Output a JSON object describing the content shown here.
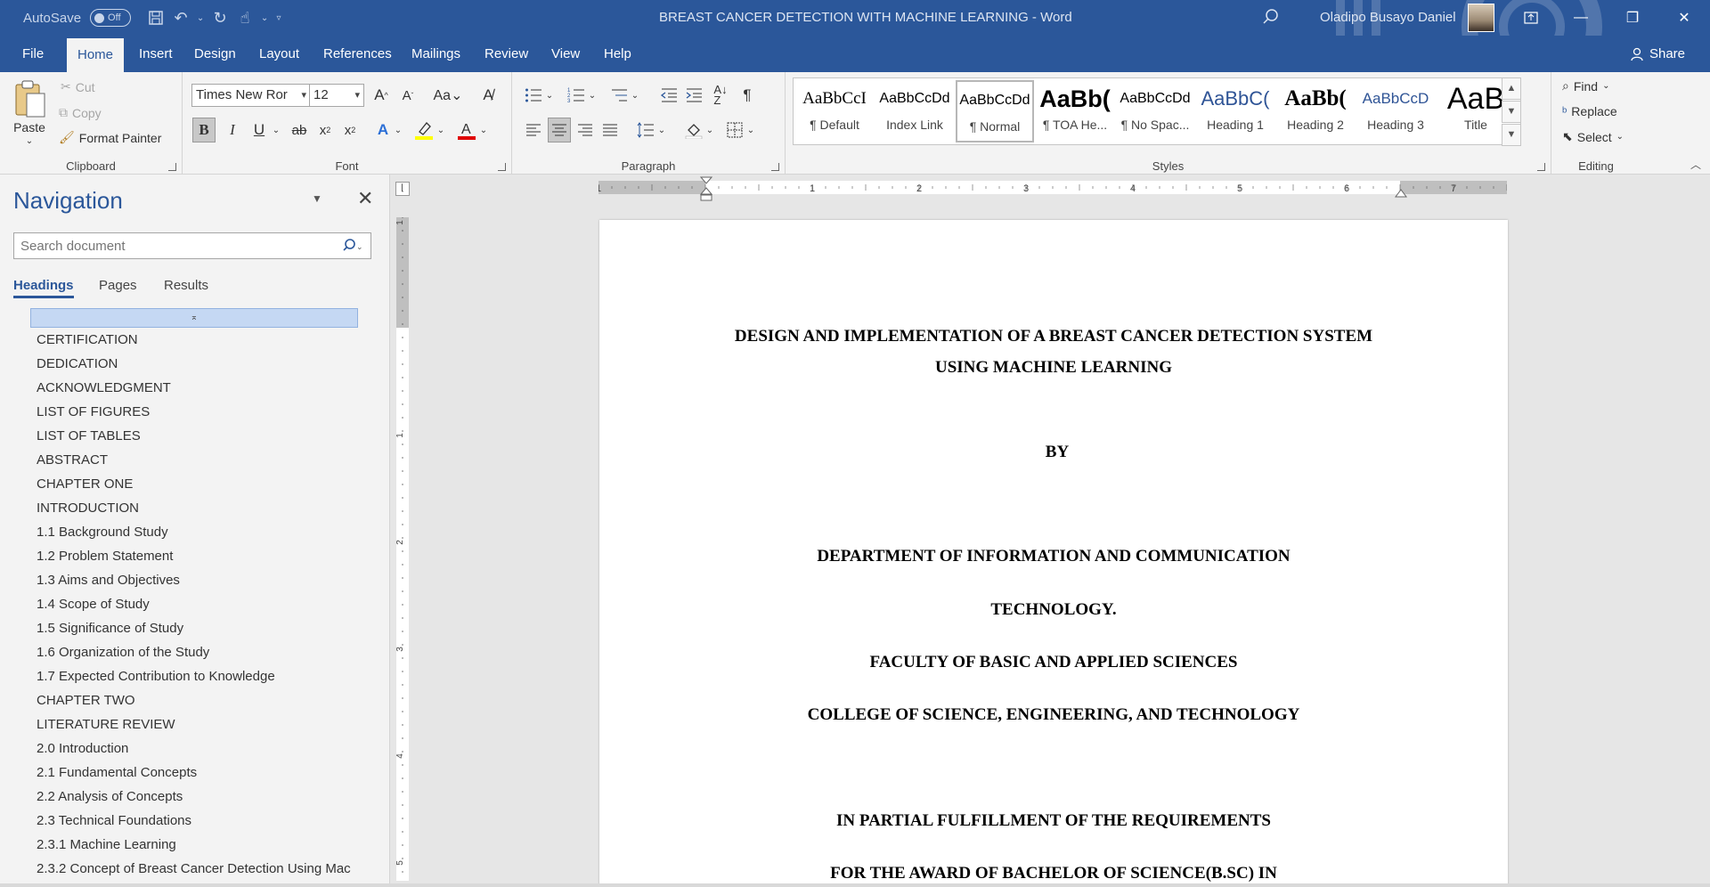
{
  "titlebar": {
    "autosave_label": "AutoSave",
    "autosave_state": "Off",
    "doc_title": "BREAST CANCER DETECTION WITH MACHINE LEARNING  -  Word",
    "user_name": "Oladipo Busayo Daniel"
  },
  "tabs": [
    "File",
    "Home",
    "Insert",
    "Design",
    "Layout",
    "References",
    "Mailings",
    "Review",
    "View",
    "Help"
  ],
  "active_tab": "Home",
  "share_label": "Share",
  "clipboard": {
    "paste": "Paste",
    "cut": "Cut",
    "copy": "Copy",
    "format_painter": "Format Painter",
    "label": "Clipboard"
  },
  "font": {
    "name": "Times New Ror",
    "size": "12",
    "label": "Font"
  },
  "paragraph": {
    "label": "Paragraph"
  },
  "styles": {
    "label": "Styles",
    "items": [
      {
        "preview": "AaBbCcI",
        "name": "¶ Default"
      },
      {
        "preview": "AaBbCcDd",
        "name": "Index Link"
      },
      {
        "preview": "AaBbCcDd",
        "name": "¶ Normal"
      },
      {
        "preview": "AaBb(",
        "name": "¶ TOA He..."
      },
      {
        "preview": "AaBbCcDd",
        "name": "¶ No Spac..."
      },
      {
        "preview": "AaBbC(",
        "name": "Heading 1"
      },
      {
        "preview": "AaBb(",
        "name": "Heading 2"
      },
      {
        "preview": "AaBbCcD",
        "name": "Heading 3"
      },
      {
        "preview": "AaB",
        "name": "Title"
      }
    ]
  },
  "editing": {
    "find": "Find",
    "replace": "Replace",
    "select": "Select",
    "label": "Editing"
  },
  "navigation": {
    "title": "Navigation",
    "search_placeholder": "Search document",
    "tabs": [
      "Headings",
      "Pages",
      "Results"
    ],
    "headings": [
      "CERTIFICATION",
      "DEDICATION",
      "ACKNOWLEDGMENT",
      "LIST OF FIGURES",
      "LIST OF TABLES",
      "ABSTRACT",
      "CHAPTER ONE",
      "INTRODUCTION",
      "1.1 Background Study",
      "1.2 Problem Statement",
      "1.3 Aims and Objectives",
      "1.4 Scope of Study",
      "1.5 Significance of Study",
      "1.6 Organization of the Study",
      "1.7 Expected Contribution to Knowledge",
      "CHAPTER TWO",
      "LITERATURE REVIEW",
      "2.0 Introduction",
      "2.1 Fundamental Concepts",
      "2.2 Analysis of Concepts",
      "2.3 Technical Foundations",
      "2.3.1 Machine Learning",
      "2.3.2 Concept of Breast Cancer Detection Using Mac"
    ]
  },
  "ruler": {
    "h_numbers": [
      "1",
      "1",
      "2",
      "3",
      "4",
      "5",
      "6",
      "7"
    ],
    "v_numbers": [
      "1",
      "1",
      "2",
      "3",
      "4",
      "5"
    ]
  },
  "document": {
    "lines": [
      "DESIGN AND IMPLEMENTATION OF A BREAST CANCER DETECTION SYSTEM",
      "USING MACHINE LEARNING",
      "BY",
      "DEPARTMENT OF INFORMATION AND COMMUNICATION",
      "TECHNOLOGY.",
      "FACULTY OF BASIC AND APPLIED SCIENCES",
      "COLLEGE OF SCIENCE, ENGINEERING, AND TECHNOLOGY",
      "IN PARTIAL FULFILLMENT OF THE REQUIREMENTS",
      "FOR THE AWARD OF BACHELOR OF SCIENCE(B.SC) IN"
    ]
  },
  "colors": {
    "brand": "#2b579a",
    "ribbon": "#f3f3f3",
    "workspace": "#e6e6e6",
    "nav_selection": "#c5d8f3"
  }
}
